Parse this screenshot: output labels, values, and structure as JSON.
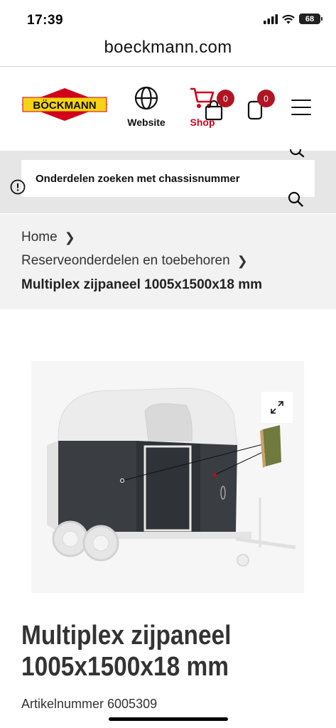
{
  "status_bar": {
    "time": "17:39",
    "battery": "68"
  },
  "browser": {
    "url": "boeckmann.com"
  },
  "header": {
    "logo_text": "BÖCKMANN",
    "website_label": "Website",
    "shop_label": "Shop",
    "cart_count": "0",
    "compare_count": "0",
    "brand_color": "#d0021b",
    "logo_yellow": "#f6d314"
  },
  "search": {
    "label": "Onderdelen zoeken met chassisnummer"
  },
  "breadcrumb": {
    "home": "Home",
    "category": "Reserveonderdelen en toebehoren",
    "current": "Multiplex zijpaneel 1005x1500x18 mm"
  },
  "product": {
    "title_line1": "Multiplex zijpaneel",
    "title_line2": "1005x1500x18 mm",
    "article_number": "Artikelnummer 6005309"
  }
}
